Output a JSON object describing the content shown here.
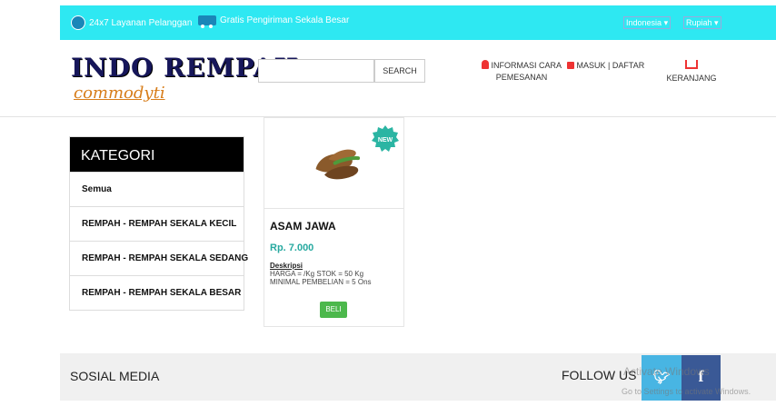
{
  "topbar": {
    "support_text": "24x7 Layanan Pelanggan",
    "shipping_text": "Gratis Pengiriman Sekala Besar",
    "language": "Indonesia",
    "currency": "Rupiah",
    "color": "#2ee8f2"
  },
  "header": {
    "logo_main": "INDO REMPAH",
    "logo_sub": "commodyti",
    "search_placeholder": "",
    "search_button": "SEARCH",
    "info_line1": "INFORMASI CARA",
    "info_line2": "PEMESANAN",
    "login_label": "MASUK | DAFTAR",
    "cart_label": "KERANJANG"
  },
  "sidebar": {
    "title": "KATEGORI",
    "items": [
      {
        "label": "Semua"
      },
      {
        "label": "REMPAH - REMPAH SEKALA KECIL"
      },
      {
        "label": "REMPAH - REMPAH SEKALA SEDANG"
      },
      {
        "label": "REMPAH - REMPAH SEKALA BESAR"
      }
    ]
  },
  "product": {
    "badge": "NEW",
    "name": "ASAM JAWA",
    "price": "Rp. 7.000",
    "desc_title": "Deskripsi",
    "desc_line1": "HARGA = /Kg STOK = 50 Kg",
    "desc_line2": "MINIMAL PEMBELIAN = 5 Ons",
    "buy_label": "BELI",
    "price_color": "#27a9a0",
    "buy_color": "#4cb84c"
  },
  "footer": {
    "social_title": "SOSIAL MEDIA",
    "follow_label": "FOLLOW US",
    "twitter_icon": "twitter-icon",
    "facebook_icon": "facebook-icon"
  },
  "watermark": {
    "line1": "Activate Windows",
    "line2": "Go to Settings to activate Windows."
  }
}
